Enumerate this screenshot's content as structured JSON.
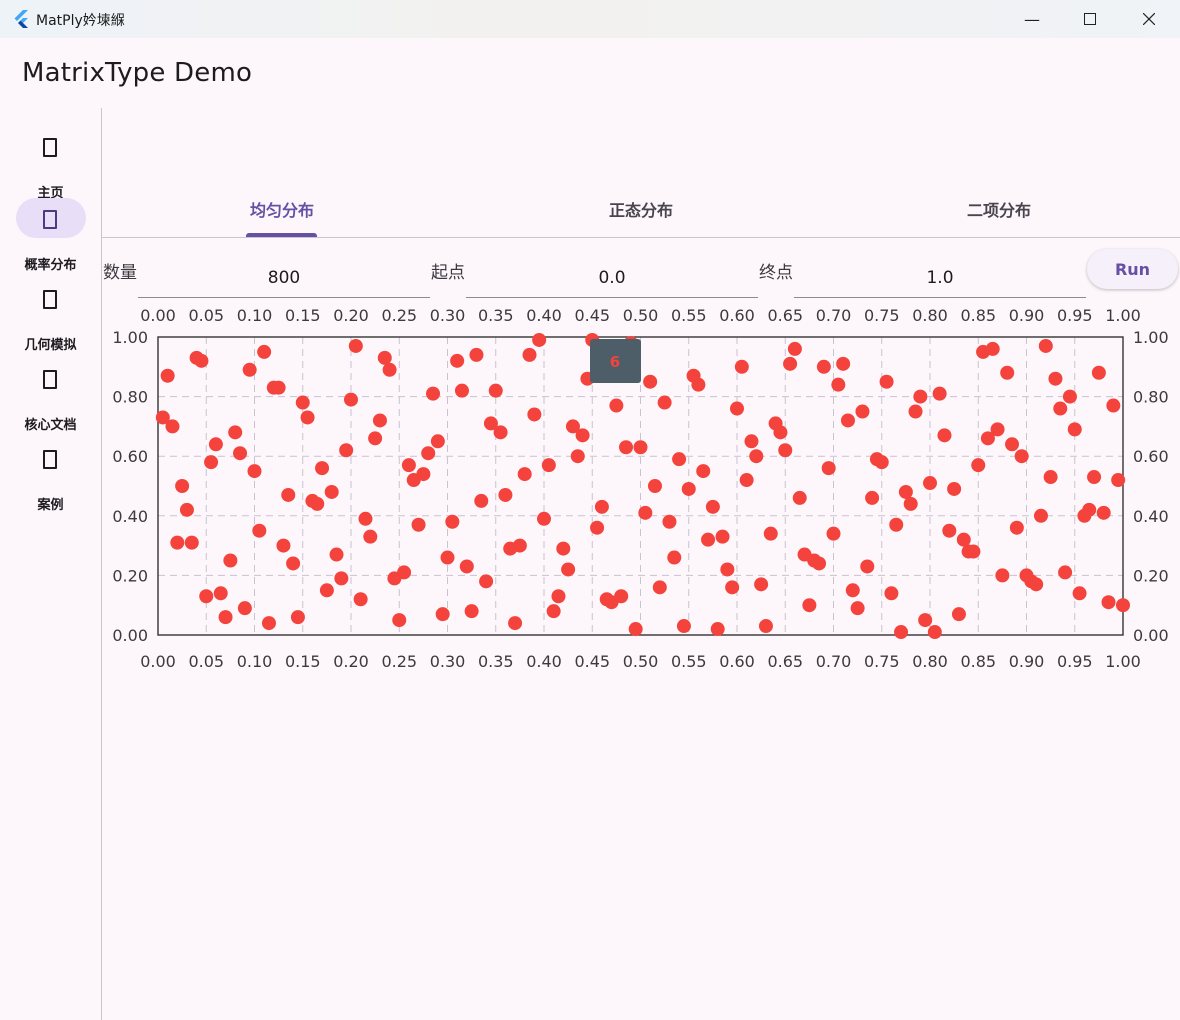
{
  "window": {
    "title": "MatPly妗堜緥",
    "minimize_icon": "minimize-icon",
    "maximize_icon": "maximize-icon",
    "close_icon": "close-icon"
  },
  "app": {
    "title": "MatrixType Demo"
  },
  "nav": {
    "items": [
      {
        "label": "主页",
        "icon": "home-icon",
        "active": false
      },
      {
        "label": "概率分布",
        "icon": "chart-icon",
        "active": true
      },
      {
        "label": "几何模拟",
        "icon": "shape-icon",
        "active": false
      },
      {
        "label": "核心文档",
        "icon": "doc-icon",
        "active": false
      },
      {
        "label": "案例",
        "icon": "case-icon",
        "active": false
      }
    ]
  },
  "tabs": [
    {
      "label": "均匀分布",
      "active": true
    },
    {
      "label": "正态分布",
      "active": false
    },
    {
      "label": "二项分布",
      "active": false
    }
  ],
  "form": {
    "count_label": "数量",
    "count_value": "800",
    "start_label": "起点",
    "start_value": "0.0",
    "end_label": "终点",
    "end_value": "1.0",
    "run_label": "Run"
  },
  "tooltip": {
    "text": "6"
  },
  "chart_data": {
    "type": "scatter",
    "title": "",
    "xlabel": "",
    "ylabel": "",
    "xlim": [
      0,
      1
    ],
    "ylim": [
      0,
      1
    ],
    "xticks": [
      "0.00",
      "0.05",
      "0.10",
      "0.15",
      "0.20",
      "0.25",
      "0.30",
      "0.35",
      "0.40",
      "0.45",
      "0.50",
      "0.55",
      "0.60",
      "0.65",
      "0.70",
      "0.75",
      "0.80",
      "0.85",
      "0.90",
      "0.95",
      "1.00"
    ],
    "yticks": [
      "0.00",
      "0.20",
      "0.40",
      "0.60",
      "0.80",
      "1.00"
    ],
    "grid": true,
    "marker_color": "#f4433c",
    "count": 800,
    "x": [
      0.01,
      0.03,
      0.05,
      0.08,
      0.11,
      0.14,
      0.17,
      0.2,
      0.22,
      0.25,
      0.28,
      0.31,
      0.34,
      0.36,
      0.39,
      0.42,
      0.45,
      0.47,
      0.5,
      0.53,
      0.56,
      0.58,
      0.61,
      0.64,
      0.67,
      0.69,
      0.72,
      0.75,
      0.78,
      0.81,
      0.83,
      0.86,
      0.89,
      0.92,
      0.94,
      0.97,
      0.99,
      0.02,
      0.06,
      0.09,
      0.12,
      0.16,
      0.19,
      0.23,
      0.26,
      0.3,
      0.33,
      0.37,
      0.4,
      0.44,
      0.48,
      0.51,
      0.55,
      0.59,
      0.62,
      0.66,
      0.7,
      0.73,
      0.77,
      0.8,
      0.84,
      0.88,
      0.91,
      0.95,
      0.98,
      0.04,
      0.07,
      0.1,
      0.13,
      0.15,
      0.18,
      0.21,
      0.24,
      0.27,
      0.29,
      0.32,
      0.35,
      0.38,
      0.41,
      0.43,
      0.46,
      0.49,
      0.52,
      0.54,
      0.57,
      0.6,
      0.63,
      0.65,
      0.68,
      0.71,
      0.74,
      0.76,
      0.79,
      0.82,
      0.85,
      0.87,
      0.9,
      0.93,
      0.96,
      1.0,
      0.005,
      0.025,
      0.045,
      0.065,
      0.085,
      0.105,
      0.125,
      0.145,
      0.165,
      0.185,
      0.205,
      0.225,
      0.245,
      0.265,
      0.285,
      0.305,
      0.325,
      0.345,
      0.365,
      0.385,
      0.405,
      0.425,
      0.445,
      0.465,
      0.485,
      0.505,
      0.525,
      0.545,
      0.565,
      0.585,
      0.605,
      0.625,
      0.645,
      0.665,
      0.685,
      0.705,
      0.725,
      0.745,
      0.765,
      0.785,
      0.805,
      0.825,
      0.845,
      0.865,
      0.885,
      0.905,
      0.925,
      0.945,
      0.965,
      0.985,
      0.015,
      0.035,
      0.055,
      0.075,
      0.095,
      0.115,
      0.135,
      0.155,
      0.175,
      0.195,
      0.215,
      0.235,
      0.255,
      0.275,
      0.295,
      0.315,
      0.335,
      0.355,
      0.375,
      0.395,
      0.415,
      0.435,
      0.455,
      0.475,
      0.495,
      0.515,
      0.535,
      0.555,
      0.575,
      0.595,
      0.615,
      0.635,
      0.655,
      0.675,
      0.695,
      0.715,
      0.735,
      0.755,
      0.775,
      0.795,
      0.815,
      0.835,
      0.855,
      0.875,
      0.895,
      0.915,
      0.935,
      0.955,
      0.975,
      0.995
    ],
    "y": [
      0.87,
      0.42,
      0.13,
      0.68,
      0.95,
      0.24,
      0.56,
      0.79,
      0.33,
      0.05,
      0.61,
      0.92,
      0.18,
      0.47,
      0.74,
      0.29,
      0.99,
      0.11,
      0.63,
      0.38,
      0.84,
      0.02,
      0.52,
      0.71,
      0.27,
      0.9,
      0.15,
      0.58,
      0.44,
      0.81,
      0.07,
      0.66,
      0.36,
      0.97,
      0.21,
      0.53,
      0.77,
      0.31,
      0.64,
      0.09,
      0.83,
      0.45,
      0.19,
      0.72,
      0.57,
      0.26,
      0.94,
      0.04,
      0.39,
      0.67,
      0.13,
      0.85,
      0.49,
      0.22,
      0.6,
      0.96,
      0.34,
      0.75,
      0.01,
      0.51,
      0.28,
      0.88,
      0.17,
      0.69,
      0.41,
      0.93,
      0.06,
      0.55,
      0.3,
      0.78,
      0.48,
      0.12,
      0.89,
      0.37,
      0.65,
      0.23,
      0.82,
      0.54,
      0.08,
      0.7,
      0.43,
      0.98,
      0.16,
      0.59,
      0.32,
      0.76,
      0.03,
      0.62,
      0.25,
      0.91,
      0.46,
      0.14,
      0.8,
      0.35,
      0.57,
      0.69,
      0.2,
      0.86,
      0.4,
      0.1,
      0.73,
      0.5,
      0.92,
      0.14,
      0.61,
      0.35,
      0.83,
      0.06,
      0.44,
      0.27,
      0.97,
      0.66,
      0.19,
      0.52,
      0.81,
      0.38,
      0.08,
      0.71,
      0.29,
      0.94,
      0.57,
      0.22,
      0.86,
      0.12,
      0.63,
      0.41,
      0.78,
      0.03,
      0.55,
      0.33,
      0.9,
      0.17,
      0.68,
      0.46,
      0.24,
      0.84,
      0.09,
      0.59,
      0.37,
      0.75,
      0.01,
      0.49,
      0.28,
      0.96,
      0.64,
      0.18,
      0.53,
      0.8,
      0.42,
      0.11,
      0.7,
      0.31,
      0.58,
      0.25,
      0.89,
      0.04,
      0.47,
      0.73,
      0.15,
      0.62,
      0.39,
      0.93,
      0.21,
      0.54,
      0.07,
      0.82,
      0.45,
      0.68,
      0.3,
      0.99,
      0.13,
      0.6,
      0.36,
      0.77,
      0.02,
      0.5,
      0.26,
      0.87,
      0.43,
      0.16,
      0.65,
      0.34,
      0.91,
      0.1,
      0.56,
      0.72,
      0.23,
      0.85,
      0.48,
      0.05,
      0.67,
      0.32,
      0.95,
      0.2,
      0.6,
      0.4,
      0.76,
      0.14,
      0.88,
      0.52
    ]
  }
}
